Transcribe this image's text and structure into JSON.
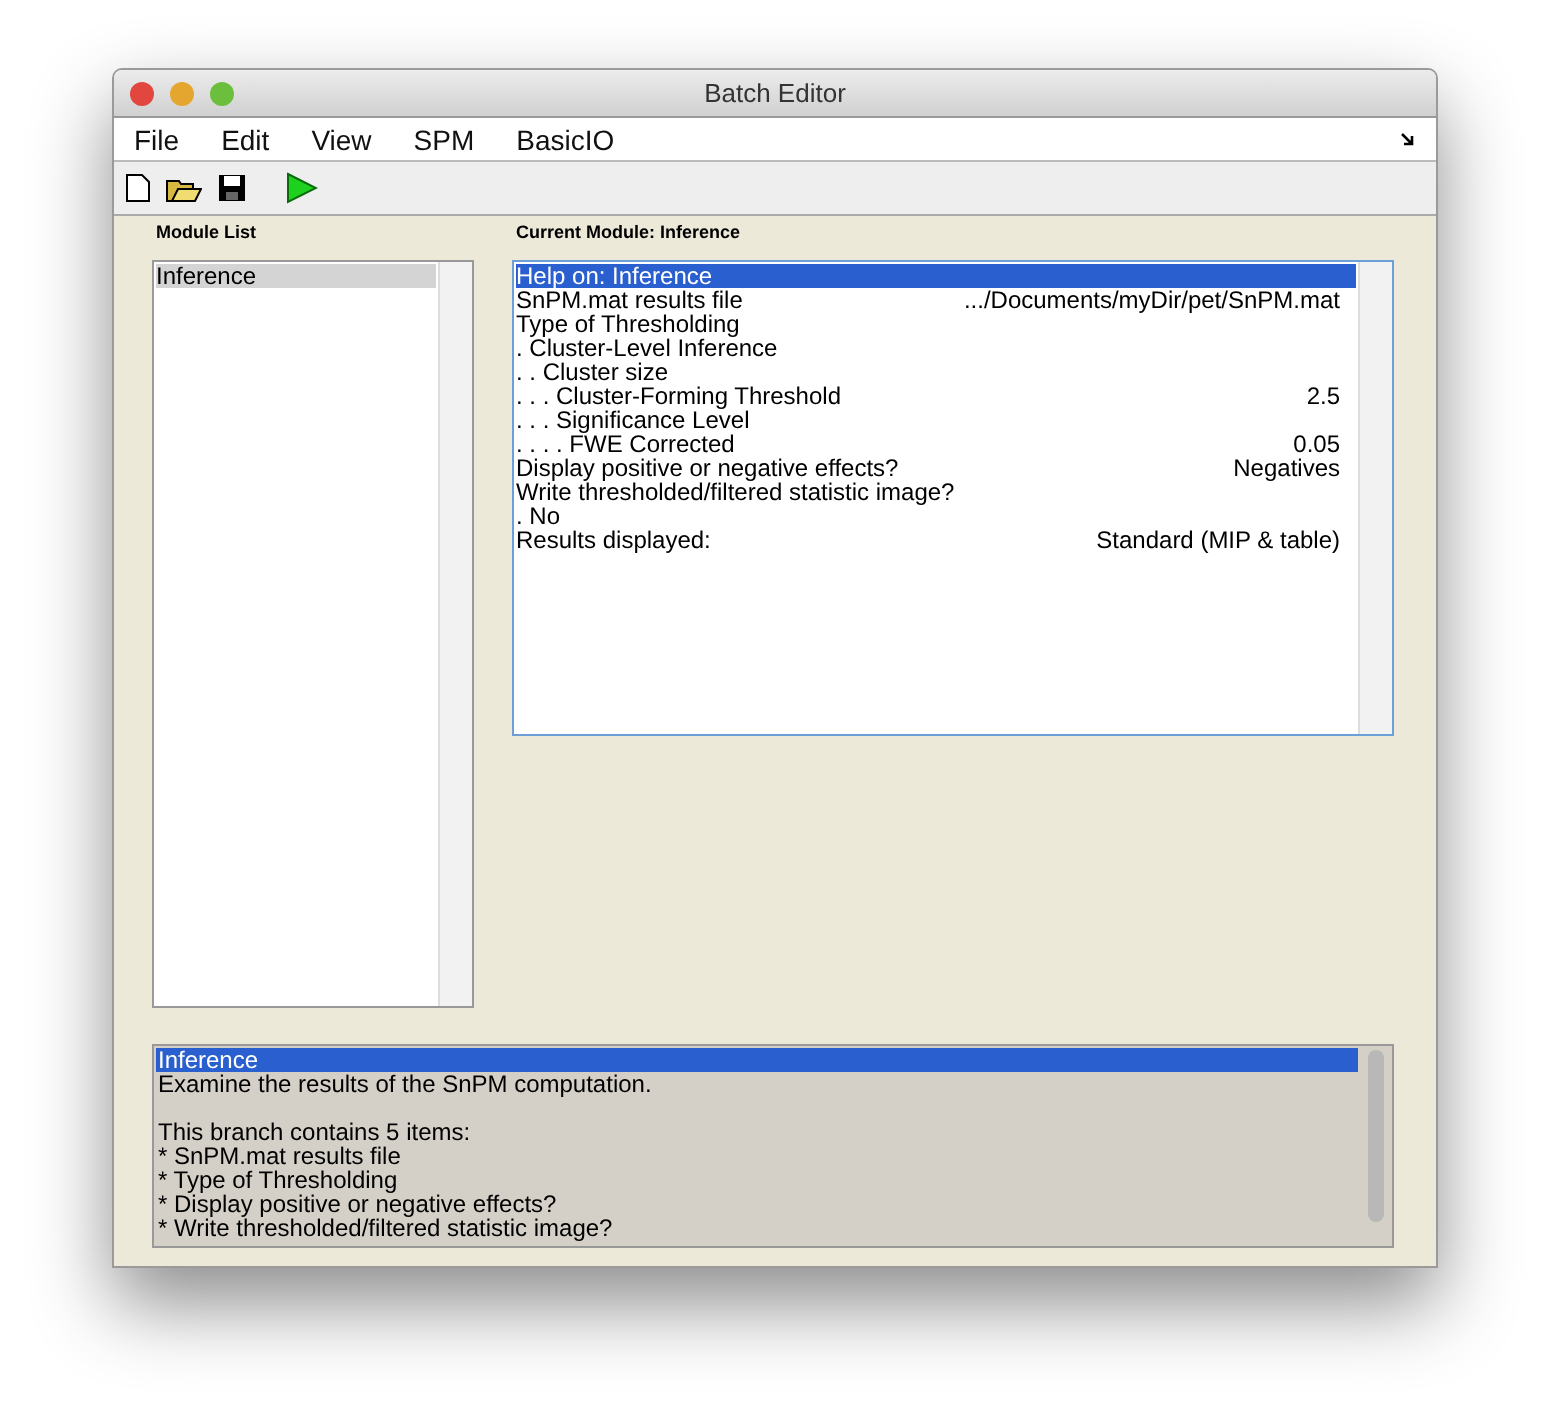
{
  "window": {
    "title": "Batch Editor"
  },
  "menu": [
    "File",
    "Edit",
    "View",
    "SPM",
    "BasicIO"
  ],
  "module_list": {
    "title": "Module List",
    "items": [
      {
        "label": "Inference",
        "selected": true
      }
    ]
  },
  "current_module": {
    "title": "Current Module: Inference",
    "rows": [
      {
        "label": "Help on: Inference",
        "selected": true
      },
      {
        "label": "SnPM.mat results file",
        "value": ".../Documents/myDir/pet/SnPM.mat",
        "selected": false
      },
      {
        "label": "Type of Thresholding",
        "selected": false
      },
      {
        "label": ". Cluster-Level Inference",
        "selected": false
      },
      {
        "label": ". . Cluster size",
        "selected": false
      },
      {
        "label": ". . . Cluster-Forming Threshold",
        "value": "2.5",
        "selected": false
      },
      {
        "label": ". . . Significance Level",
        "selected": false
      },
      {
        "label": ". . . . FWE Corrected",
        "value": "0.05",
        "selected": false
      },
      {
        "label": "Display positive or negative effects?",
        "value": "Negatives",
        "selected": false
      },
      {
        "label": "Write thresholded/filtered statistic image?",
        "selected": false
      },
      {
        "label": ". No",
        "selected": false
      },
      {
        "label": "Results displayed:",
        "value": "Standard (MIP & table)",
        "selected": false
      }
    ]
  },
  "help": {
    "heading": {
      "text": "Inference",
      "selected": true
    },
    "paragraphs": [
      [
        "Examine the results of the SnPM computation."
      ],
      [
        "This branch contains 5 items:",
        "* SnPM.mat results file",
        "* Type of Thresholding",
        "* Display positive or negative effects?",
        "* Write thresholded/filtered statistic image?"
      ]
    ]
  }
}
